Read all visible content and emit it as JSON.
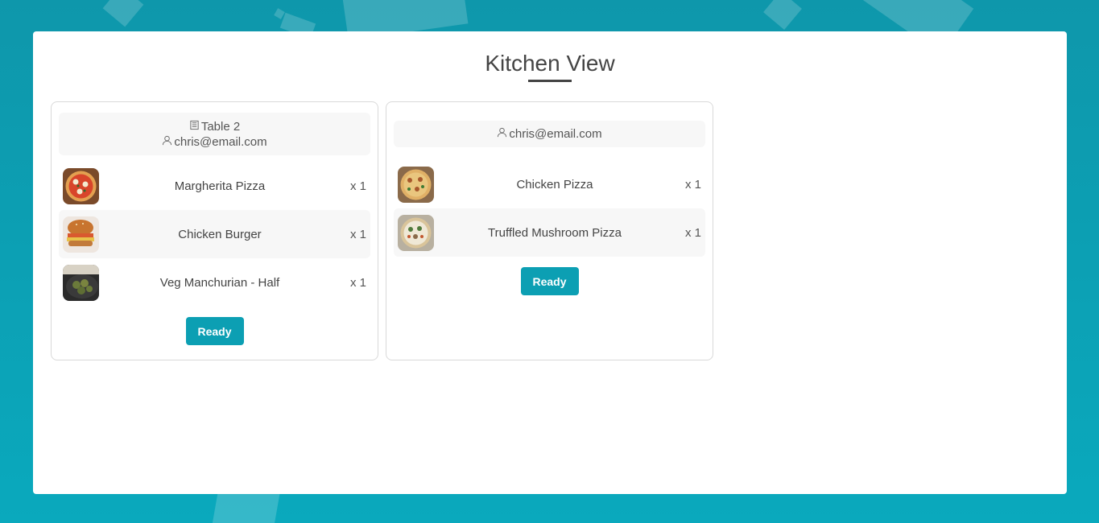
{
  "page": {
    "title": "Kitchen View"
  },
  "orders": [
    {
      "table": "Table 2",
      "email": "chris@email.com",
      "items": [
        {
          "name": "Margherita Pizza",
          "qty": "x 1",
          "image": "margherita-pizza"
        },
        {
          "name": "Chicken Burger",
          "qty": "x 1",
          "image": "chicken-burger"
        },
        {
          "name": "Veg Manchurian - Half",
          "qty": "x 1",
          "image": "veg-manchurian"
        }
      ],
      "button": "Ready"
    },
    {
      "email": "chris@email.com",
      "items": [
        {
          "name": "Chicken Pizza",
          "qty": "x 1",
          "image": "chicken-pizza"
        },
        {
          "name": "Truffled Mushroom Pizza",
          "qty": "x 1",
          "image": "truffled-mushroom-pizza"
        }
      ],
      "button": "Ready"
    }
  ],
  "colors": {
    "accent": "#0c9fb3",
    "background": "#0e97ab"
  }
}
